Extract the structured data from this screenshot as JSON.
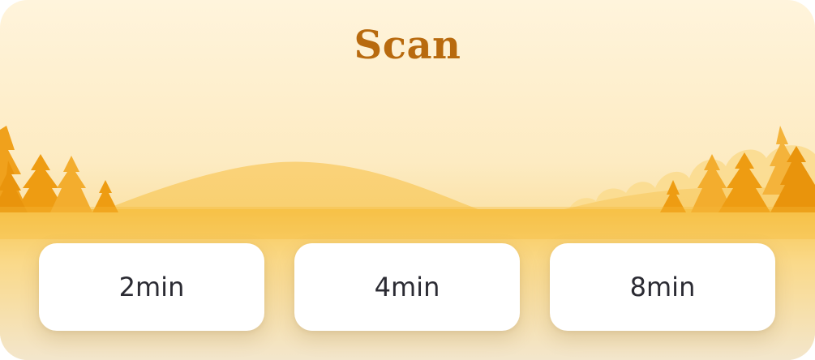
{
  "title": "Scan",
  "durations": [
    {
      "label": "2min"
    },
    {
      "label": "4min"
    },
    {
      "label": "8min"
    }
  ],
  "colors": {
    "title": "#b86a0e",
    "background_top": "#fff4dc",
    "hill": "#f9cf6c",
    "trees": "#f0a11c",
    "button_bg": "#ffffff",
    "button_text": "#2b2b33"
  }
}
